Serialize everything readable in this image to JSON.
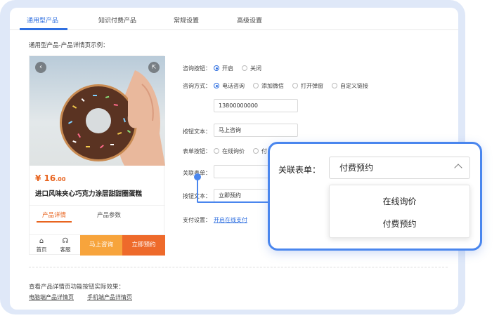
{
  "tabs": [
    "通用型产品",
    "知识付费产品",
    "常规设置",
    "高级设置"
  ],
  "example_label": "通用型产品-产品详情页示例：",
  "product": {
    "price_symbol": "¥",
    "price_int": "16",
    "price_dec": ".00",
    "name": "进口风味夹心巧克力涂层甜甜圈蛋糕",
    "tabs": [
      "产品详情",
      "产品参数"
    ],
    "bottom_bar": {
      "home": "首页",
      "service": "客服",
      "consult": "马上咨询",
      "book": "立即预约"
    }
  },
  "form": {
    "consult_button": {
      "label": "咨询按钮：",
      "options": [
        "开启",
        "关闭"
      ],
      "selected": "开启"
    },
    "consult_method": {
      "label": "咨询方式：",
      "options": [
        "电话咨询",
        "添加微信",
        "打开弹窗",
        "自定义链接"
      ],
      "selected": "电话咨询"
    },
    "phone_value": "13800000000",
    "button_text": {
      "label": "按钮文本：",
      "value": "马上咨询"
    },
    "form_button": {
      "label": "表单按钮：",
      "options": [
        "在线询价",
        "付"
      ]
    },
    "linked_form": {
      "label": "关联表单：",
      "value": ""
    },
    "button_text2": {
      "label": "按钮文本：",
      "value": "立即预约"
    },
    "payment": {
      "label": "支付设置：",
      "link": "开启在线支付"
    }
  },
  "bottom": {
    "title": "查看产品详情页功能按钮实际效果：",
    "links": [
      "电脑端产品详情页",
      "手机端产品详情页"
    ]
  },
  "overlay": {
    "label": "关联表单：",
    "selected": "付费预约",
    "options": [
      "在线询价",
      "付费预约"
    ]
  },
  "colors": {
    "accent": "#2f6fe0",
    "orange": "#ee6a2b",
    "light_orange": "#f7a43c",
    "highlight": "#4a86ee"
  }
}
